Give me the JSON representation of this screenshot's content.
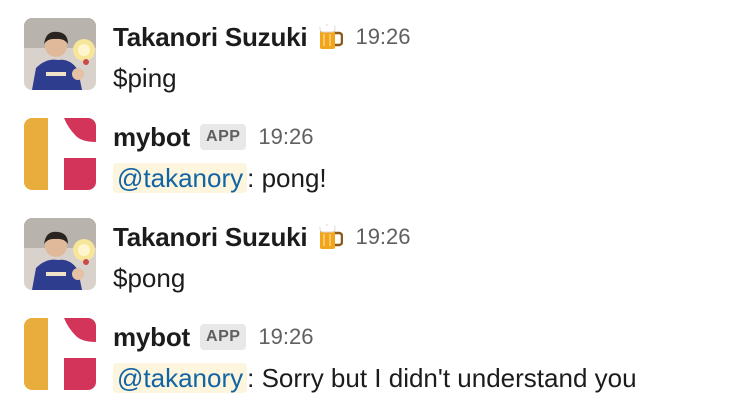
{
  "messages": [
    {
      "author": "Takanori Suzuki",
      "status_icon": "beer-mug-icon",
      "time": "19:26",
      "text": "$ping"
    },
    {
      "author": "mybot",
      "badge": "APP",
      "time": "19:26",
      "mention": "@takanory",
      "text": ": pong!"
    },
    {
      "author": "Takanori Suzuki",
      "status_icon": "beer-mug-icon",
      "time": "19:26",
      "text": "$pong"
    },
    {
      "author": "mybot",
      "badge": "APP",
      "time": "19:26",
      "mention": "@takanory",
      "text": ": Sorry but I didn't understand you"
    }
  ],
  "colors": {
    "mention_bg": "#fdf5dd",
    "mention_text": "#1264a3",
    "bot_yellow": "#e8ad3c",
    "bot_red": "#d3355a"
  }
}
